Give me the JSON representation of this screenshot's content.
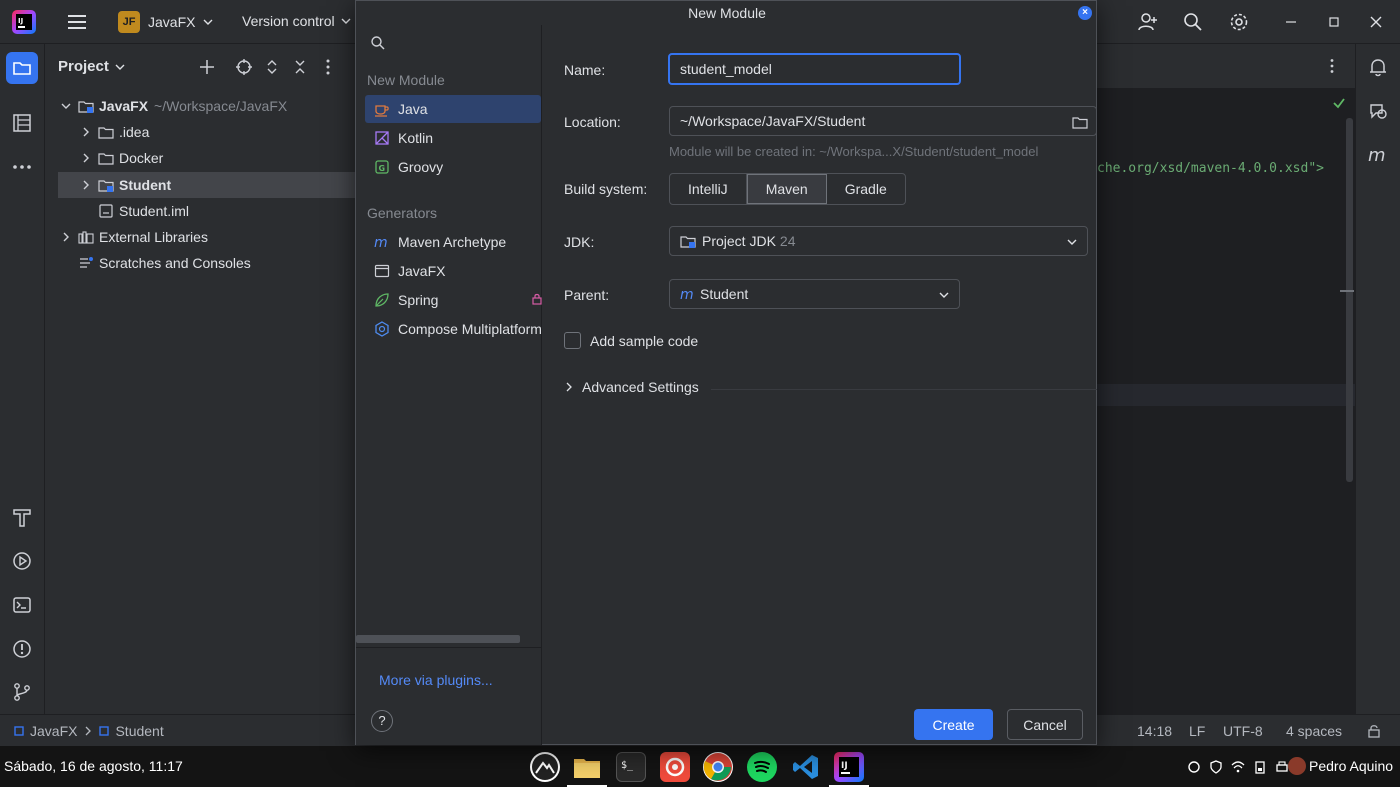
{
  "titlebar": {
    "project_badge": "JF",
    "project_name": "JavaFX",
    "vcs_label": "Version control"
  },
  "project_panel": {
    "title": "Project",
    "tree": [
      {
        "label": "JavaFX",
        "hint": "~/Workspace/JavaFX",
        "bold": true
      },
      {
        "label": ".idea"
      },
      {
        "label": "Docker"
      },
      {
        "label": "Student",
        "bold": true,
        "selected": true
      },
      {
        "label": "Student.iml"
      },
      {
        "label": "External Libraries"
      },
      {
        "label": "Scratches and Consoles"
      }
    ]
  },
  "editor": {
    "code_fragment": "che.org/xsd/maven-4.0.0.xsd\">"
  },
  "dialog": {
    "title": "New Module",
    "sidebar": {
      "section_new": "New Module",
      "items_new": [
        {
          "label": "Java",
          "icon": "java-cup-icon",
          "selected": true
        },
        {
          "label": "Kotlin",
          "icon": "kotlin-icon"
        },
        {
          "label": "Groovy",
          "icon": "groovy-icon"
        }
      ],
      "section_generators": "Generators",
      "items_generators": [
        {
          "label": "Maven Archetype",
          "icon": "maven-icon"
        },
        {
          "label": "JavaFX",
          "icon": "javafx-window-icon"
        },
        {
          "label": "Spring",
          "icon": "spring-leaf-icon"
        },
        {
          "label": "Compose Multiplatform",
          "icon": "compose-icon"
        }
      ],
      "more_link": "More via plugins...",
      "help": "?"
    },
    "form": {
      "name_label": "Name:",
      "name_value": "student_model",
      "location_label": "Location:",
      "location_value": "~/Workspace/JavaFX/Student",
      "location_hint": "Module will be created in: ~/Workspa...X/Student/student_model",
      "build_label": "Build system:",
      "build_options": [
        "IntelliJ",
        "Maven",
        "Gradle"
      ],
      "build_selected": "Maven",
      "jdk_label": "JDK:",
      "jdk_value": "Project JDK",
      "jdk_version": "24",
      "parent_label": "Parent:",
      "parent_value": "Student",
      "sample_code_label": "Add sample code",
      "sample_code_checked": false,
      "advanced_label": "Advanced Settings"
    },
    "buttons": {
      "create": "Create",
      "cancel": "Cancel"
    }
  },
  "statusbar": {
    "breadcrumb_root": "JavaFX",
    "breadcrumb_child": "Student",
    "position": "14:18",
    "line_sep": "LF",
    "encoding": "UTF-8",
    "indent": "4 spaces"
  },
  "taskbar": {
    "datetime": "Sábado, 16 de agosto, 11:17",
    "user": "Pedro Aquino"
  },
  "colors": {
    "accent": "#3574f0",
    "panel": "#2b2d30",
    "editor_bg": "#1e1f22",
    "selection": "#2e436e",
    "code_string": "#6aab73"
  }
}
